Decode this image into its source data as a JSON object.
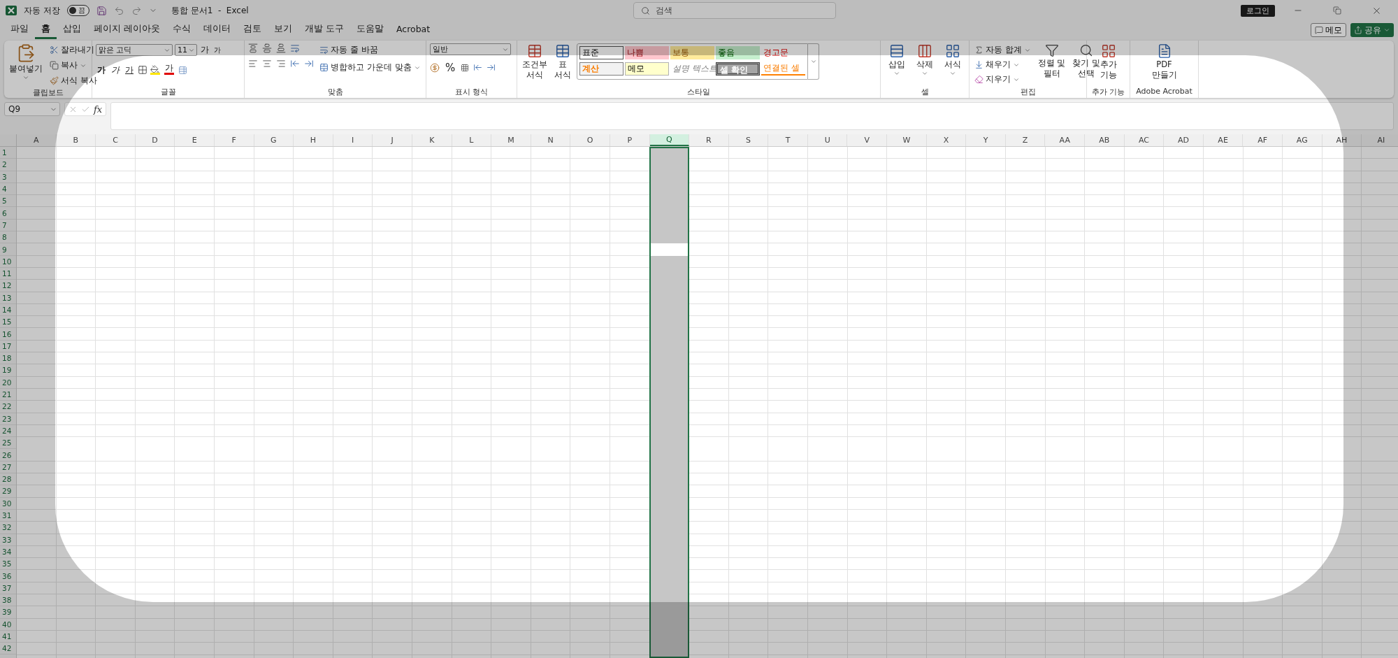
{
  "title_bar": {
    "autosave_label": "자동 저장",
    "autosave_toggle": {
      "text": "끔",
      "on": false
    },
    "document_title": "통합 문서1  -  Excel",
    "search": {
      "placeholder": "검색"
    },
    "login": "로그인"
  },
  "tabs": [
    {
      "label": "파일",
      "selected": false
    },
    {
      "label": "홈",
      "selected": true
    },
    {
      "label": "삽입",
      "selected": false
    },
    {
      "label": "페이지 레이아웃",
      "selected": false
    },
    {
      "label": "수식",
      "selected": false
    },
    {
      "label": "데이터",
      "selected": false
    },
    {
      "label": "검토",
      "selected": false
    },
    {
      "label": "보기",
      "selected": false
    },
    {
      "label": "개발 도구",
      "selected": false
    },
    {
      "label": "도움말",
      "selected": false
    },
    {
      "label": "Acrobat",
      "selected": false
    }
  ],
  "tab_actions": {
    "memo": "메모",
    "share": "공유"
  },
  "ribbon": {
    "clipboard": {
      "label": "클립보드",
      "paste": "붙여넣기",
      "cut": "잘라내기",
      "copy": "복사",
      "format_painter": "서식 복사"
    },
    "font": {
      "label": "글꼴",
      "font_name": "맑은 고딕",
      "font_size": "11",
      "grow": "가",
      "shrink": "가",
      "bold": "가",
      "italic": "가",
      "underline": "가",
      "font_color": "가"
    },
    "alignment": {
      "label": "맞춤",
      "wrap": "자동 줄 바꿈",
      "merge": "병합하고 가운데 맞춤"
    },
    "number": {
      "label": "표시 형식",
      "format": "일반",
      "percent": "%"
    },
    "styles": {
      "label": "스타일",
      "conditional": [
        "조건부",
        "서식"
      ],
      "table": [
        "표",
        "서식"
      ],
      "cells": [
        {
          "text": "표준",
          "kind": "normal"
        },
        {
          "text": "나쁨",
          "kind": "bad"
        },
        {
          "text": "보통",
          "kind": "neutral"
        },
        {
          "text": "좋음",
          "kind": "good"
        },
        {
          "text": "경고문",
          "kind": "warning"
        },
        {
          "text": "계산",
          "kind": "calculation"
        },
        {
          "text": "메모",
          "kind": "note"
        },
        {
          "text": "설명 텍스트",
          "kind": "explanatory"
        },
        {
          "text": "셀 확인",
          "kind": "check"
        },
        {
          "text": "연결된 셀",
          "kind": "linked"
        }
      ]
    },
    "cells": {
      "label": "셀",
      "insert": "삽입",
      "delete": "삭제",
      "format": "서식"
    },
    "editing": {
      "label": "편집",
      "autosum": "자동 합계",
      "fill": "채우기",
      "clear": "지우기",
      "sort": [
        "정렬 및",
        "필터"
      ],
      "find": [
        "찾기 및",
        "선택"
      ]
    },
    "addins": {
      "label": "추가 기능",
      "button": [
        "추가",
        "기능"
      ]
    },
    "acrobat": {
      "label": "Adobe Acrobat",
      "button": [
        "PDF",
        "만들기"
      ]
    }
  },
  "formula_bar": {
    "name_box": "Q9",
    "fx": "fx"
  },
  "sheet": {
    "columns": [
      {
        "label": "A",
        "selected": false
      },
      {
        "label": "B",
        "selected": false
      },
      {
        "label": "C",
        "selected": false
      },
      {
        "label": "D",
        "selected": false
      },
      {
        "label": "E",
        "selected": false
      },
      {
        "label": "F",
        "selected": false
      },
      {
        "label": "G",
        "selected": false
      },
      {
        "label": "H",
        "selected": false
      },
      {
        "label": "I",
        "selected": false
      },
      {
        "label": "J",
        "selected": false
      },
      {
        "label": "K",
        "selected": false
      },
      {
        "label": "L",
        "selected": false
      },
      {
        "label": "M",
        "selected": false
      },
      {
        "label": "N",
        "selected": false
      },
      {
        "label": "O",
        "selected": false
      },
      {
        "label": "P",
        "selected": false
      },
      {
        "label": "Q",
        "selected": true
      },
      {
        "label": "R",
        "selected": false
      },
      {
        "label": "S",
        "selected": false
      },
      {
        "label": "T",
        "selected": false
      },
      {
        "label": "U",
        "selected": false
      },
      {
        "label": "V",
        "selected": false
      },
      {
        "label": "W",
        "selected": false
      },
      {
        "label": "X",
        "selected": false
      },
      {
        "label": "Y",
        "selected": false
      },
      {
        "label": "Z",
        "selected": false
      },
      {
        "label": "AA",
        "selected": false
      },
      {
        "label": "AB",
        "selected": false
      },
      {
        "label": "AC",
        "selected": false
      },
      {
        "label": "AD",
        "selected": false
      },
      {
        "label": "AE",
        "selected": false
      },
      {
        "label": "AF",
        "selected": false
      },
      {
        "label": "AG",
        "selected": false
      },
      {
        "label": "AH",
        "selected": false
      },
      {
        "label": "AI",
        "selected": false
      }
    ],
    "rows": [
      {
        "label": "1",
        "active": false
      },
      {
        "label": "2",
        "active": false
      },
      {
        "label": "3",
        "active": false
      },
      {
        "label": "4",
        "active": false
      },
      {
        "label": "5",
        "active": false
      },
      {
        "label": "6",
        "active": false
      },
      {
        "label": "7",
        "active": false
      },
      {
        "label": "8",
        "active": false
      },
      {
        "label": "9",
        "active": true
      },
      {
        "label": "10",
        "active": false
      },
      {
        "label": "11",
        "active": false
      },
      {
        "label": "12",
        "active": false
      },
      {
        "label": "13",
        "active": false
      },
      {
        "label": "14",
        "active": false
      },
      {
        "label": "15",
        "active": false
      },
      {
        "label": "16",
        "active": false
      },
      {
        "label": "17",
        "active": false
      },
      {
        "label": "18",
        "active": false
      },
      {
        "label": "19",
        "active": false
      },
      {
        "label": "20",
        "active": false
      },
      {
        "label": "21",
        "active": false
      },
      {
        "label": "22",
        "active": false
      },
      {
        "label": "23",
        "active": false
      },
      {
        "label": "24",
        "active": false
      },
      {
        "label": "25",
        "active": false
      },
      {
        "label": "26",
        "active": false
      },
      {
        "label": "27",
        "active": false
      },
      {
        "label": "28",
        "active": false
      },
      {
        "label": "29",
        "active": false
      },
      {
        "label": "30",
        "active": false
      },
      {
        "label": "31",
        "active": false
      },
      {
        "label": "32",
        "active": false
      },
      {
        "label": "33",
        "active": false
      },
      {
        "label": "34",
        "active": false
      },
      {
        "label": "35",
        "active": false
      },
      {
        "label": "36",
        "active": false
      },
      {
        "label": "37",
        "active": false
      },
      {
        "label": "38",
        "active": false
      },
      {
        "label": "39",
        "active": false
      },
      {
        "label": "40",
        "active": false
      },
      {
        "label": "41",
        "active": false
      },
      {
        "label": "42",
        "active": false
      }
    ]
  }
}
